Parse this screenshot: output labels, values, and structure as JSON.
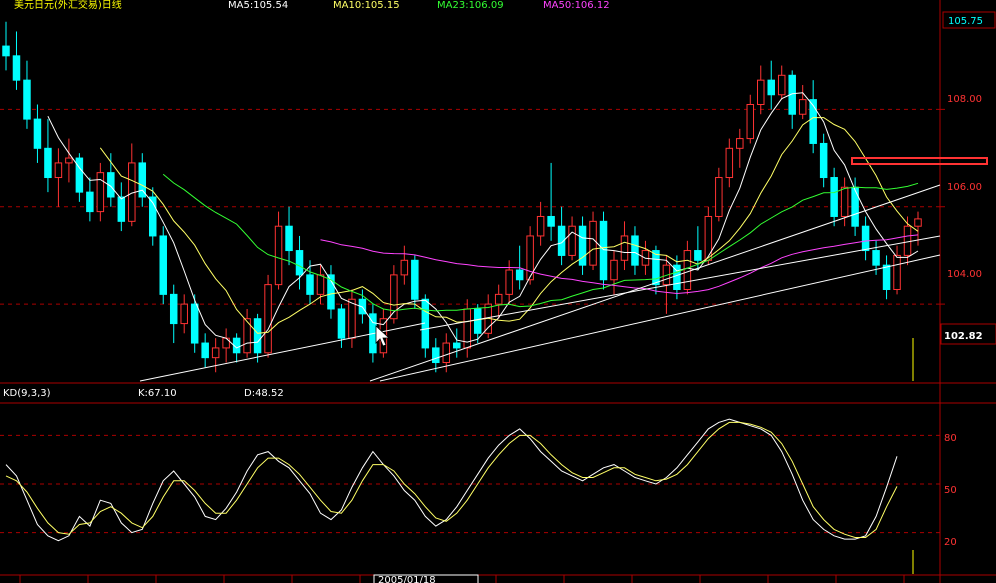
{
  "header": {
    "title": "美元日元(外汇交易)日线",
    "ma_labels": [
      {
        "text": "MA5:105.54",
        "color": "#ffffff"
      },
      {
        "text": "MA10:105.15",
        "color": "#ffff66"
      },
      {
        "text": "MA23:106.09",
        "color": "#33ff33"
      },
      {
        "text": "MA50:106.12",
        "color": "#ff44ff"
      }
    ]
  },
  "price_panel": {
    "last_price": "105.75",
    "current_price": "102.82",
    "y_ticks": [
      "108.00",
      "106.00",
      "104.00"
    ]
  },
  "kd_panel": {
    "title": "KD(9,3,3)",
    "k_label": "K:67.10",
    "d_label": "D:48.52",
    "y_ticks": [
      "80",
      "50",
      "20"
    ]
  },
  "time_axis": {
    "highlight_label": "2005/01/18"
  },
  "colors": {
    "up": "#ff3333",
    "down": "#00ffff",
    "grid": "#aa0000",
    "axis": "#aa0000",
    "ma5": "#ffffff",
    "ma10": "#ffff66",
    "ma23": "#33ff33",
    "ma50": "#ff44ff",
    "k_line": "#ffffff",
    "d_line": "#ffff66",
    "trend_lines": "#ffffff",
    "highlight_box": "#ff3333"
  },
  "chart_data": {
    "type": "candlestick",
    "ylim": [
      102.4,
      110.0
    ],
    "y_ticks": [
      104,
      106,
      108
    ],
    "grid": true,
    "candles": [
      [
        109.3,
        109.8,
        108.8,
        109.1
      ],
      [
        109.1,
        109.6,
        108.4,
        108.6
      ],
      [
        108.6,
        109.0,
        107.6,
        107.8
      ],
      [
        107.8,
        108.1,
        106.9,
        107.2
      ],
      [
        107.2,
        107.8,
        106.3,
        106.6
      ],
      [
        106.6,
        107.2,
        106.0,
        106.9
      ],
      [
        106.9,
        107.4,
        106.5,
        107.0
      ],
      [
        107.0,
        107.1,
        106.1,
        106.3
      ],
      [
        106.3,
        106.6,
        105.7,
        105.9
      ],
      [
        105.9,
        106.9,
        105.7,
        106.7
      ],
      [
        106.7,
        107.1,
        106.0,
        106.2
      ],
      [
        106.2,
        106.5,
        105.5,
        105.7
      ],
      [
        105.7,
        107.3,
        105.6,
        106.9
      ],
      [
        106.9,
        107.1,
        106.0,
        106.2
      ],
      [
        106.2,
        106.4,
        105.2,
        105.4
      ],
      [
        105.4,
        105.6,
        104.0,
        104.2
      ],
      [
        104.2,
        104.4,
        103.2,
        103.6
      ],
      [
        103.6,
        104.2,
        103.4,
        104.0
      ],
      [
        104.0,
        104.2,
        103.0,
        103.2
      ],
      [
        103.2,
        103.4,
        102.7,
        102.9
      ],
      [
        102.9,
        103.3,
        102.6,
        103.1
      ],
      [
        103.1,
        103.5,
        102.8,
        103.3
      ],
      [
        103.3,
        103.4,
        102.8,
        103.0
      ],
      [
        103.0,
        103.9,
        102.9,
        103.7
      ],
      [
        103.7,
        103.8,
        102.8,
        103.0
      ],
      [
        103.0,
        104.6,
        102.9,
        104.4
      ],
      [
        104.4,
        105.9,
        104.3,
        105.6
      ],
      [
        105.6,
        106.0,
        104.8,
        105.1
      ],
      [
        105.1,
        105.4,
        104.3,
        104.6
      ],
      [
        104.6,
        104.9,
        104.0,
        104.2
      ],
      [
        104.2,
        104.8,
        104.0,
        104.6
      ],
      [
        104.6,
        104.8,
        103.7,
        103.9
      ],
      [
        103.9,
        104.0,
        103.1,
        103.3
      ],
      [
        103.3,
        104.3,
        103.1,
        104.1
      ],
      [
        104.1,
        104.3,
        103.6,
        103.8
      ],
      [
        103.8,
        104.0,
        102.8,
        103.0
      ],
      [
        103.0,
        103.9,
        102.9,
        103.7
      ],
      [
        103.7,
        104.8,
        103.6,
        104.6
      ],
      [
        104.6,
        105.2,
        104.4,
        104.9
      ],
      [
        104.9,
        105.0,
        103.9,
        104.1
      ],
      [
        104.1,
        104.2,
        102.9,
        103.1
      ],
      [
        103.1,
        103.3,
        102.6,
        102.8
      ],
      [
        102.8,
        103.4,
        102.6,
        103.2
      ],
      [
        103.2,
        103.5,
        102.9,
        103.1
      ],
      [
        103.1,
        104.1,
        102.9,
        103.9
      ],
      [
        103.9,
        104.0,
        103.2,
        103.4
      ],
      [
        103.4,
        104.2,
        103.3,
        104.0
      ],
      [
        104.0,
        104.4,
        103.7,
        104.2
      ],
      [
        104.2,
        104.9,
        104.0,
        104.7
      ],
      [
        104.7,
        105.2,
        104.3,
        104.5
      ],
      [
        104.5,
        105.6,
        104.4,
        105.4
      ],
      [
        105.4,
        106.1,
        105.2,
        105.8
      ],
      [
        105.8,
        106.9,
        105.3,
        105.6
      ],
      [
        105.6,
        106.0,
        104.8,
        105.0
      ],
      [
        105.0,
        105.8,
        104.9,
        105.6
      ],
      [
        105.6,
        105.8,
        104.6,
        104.8
      ],
      [
        104.8,
        105.9,
        104.7,
        105.7
      ],
      [
        105.7,
        105.9,
        104.3,
        104.5
      ],
      [
        104.5,
        105.1,
        104.2,
        104.9
      ],
      [
        104.9,
        105.7,
        104.7,
        105.4
      ],
      [
        105.4,
        105.6,
        104.6,
        104.8
      ],
      [
        104.8,
        105.3,
        104.6,
        105.1
      ],
      [
        105.1,
        105.2,
        104.2,
        104.4
      ],
      [
        104.4,
        105.0,
        103.8,
        104.8
      ],
      [
        104.8,
        105.0,
        104.1,
        104.3
      ],
      [
        104.3,
        105.3,
        104.2,
        105.1
      ],
      [
        105.1,
        105.6,
        104.7,
        104.9
      ],
      [
        104.9,
        106.0,
        104.8,
        105.8
      ],
      [
        105.8,
        106.8,
        105.7,
        106.6
      ],
      [
        106.6,
        107.4,
        106.4,
        107.2
      ],
      [
        107.2,
        107.6,
        106.8,
        107.4
      ],
      [
        107.4,
        108.3,
        107.3,
        108.1
      ],
      [
        108.1,
        108.9,
        107.9,
        108.6
      ],
      [
        108.6,
        109.0,
        108.0,
        108.3
      ],
      [
        108.3,
        108.9,
        108.2,
        108.7
      ],
      [
        108.7,
        108.8,
        107.6,
        107.9
      ],
      [
        107.9,
        108.5,
        107.8,
        108.2
      ],
      [
        108.2,
        108.6,
        107.1,
        107.3
      ],
      [
        107.3,
        107.5,
        106.4,
        106.6
      ],
      [
        106.6,
        106.8,
        105.6,
        105.8
      ],
      [
        105.8,
        106.6,
        105.6,
        106.4
      ],
      [
        106.4,
        106.6,
        105.4,
        105.6
      ],
      [
        105.6,
        105.8,
        104.9,
        105.1
      ],
      [
        105.1,
        105.3,
        104.6,
        104.8
      ],
      [
        104.8,
        105.0,
        104.1,
        104.3
      ],
      [
        104.3,
        105.2,
        104.2,
        105.0
      ],
      [
        105.0,
        105.8,
        104.8,
        105.6
      ],
      [
        105.6,
        105.9,
        105.2,
        105.75
      ]
    ],
    "kd": {
      "ylim": [
        0,
        100
      ],
      "y_ticks": [
        20,
        50,
        80
      ],
      "k": [
        62,
        55,
        40,
        25,
        18,
        15,
        18,
        30,
        24,
        40,
        38,
        26,
        20,
        22,
        38,
        52,
        58,
        50,
        42,
        30,
        28,
        35,
        45,
        58,
        68,
        70,
        64,
        60,
        52,
        44,
        32,
        28,
        34,
        48,
        60,
        70,
        62,
        55,
        46,
        40,
        30,
        24,
        28,
        36,
        46,
        56,
        66,
        74,
        80,
        84,
        78,
        70,
        64,
        58,
        55,
        52,
        56,
        60,
        62,
        58,
        54,
        52,
        50,
        54,
        60,
        68,
        76,
        84,
        88,
        90,
        88,
        86,
        84,
        80,
        70,
        56,
        40,
        28,
        22,
        18,
        16,
        16,
        18,
        30,
        48,
        67.1
      ],
      "d": [
        55,
        52,
        45,
        35,
        26,
        20,
        19,
        25,
        26,
        33,
        36,
        32,
        26,
        23,
        30,
        42,
        52,
        52,
        46,
        38,
        32,
        32,
        40,
        50,
        60,
        66,
        66,
        62,
        56,
        48,
        40,
        33,
        32,
        40,
        52,
        62,
        62,
        58,
        50,
        44,
        36,
        29,
        27,
        32,
        40,
        50,
        60,
        68,
        75,
        80,
        80,
        75,
        68,
        62,
        57,
        54,
        54,
        57,
        60,
        60,
        56,
        54,
        52,
        53,
        56,
        62,
        70,
        78,
        84,
        88,
        88,
        87,
        85,
        82,
        75,
        64,
        50,
        36,
        28,
        22,
        19,
        17,
        17,
        22,
        36,
        48.52
      ]
    }
  }
}
